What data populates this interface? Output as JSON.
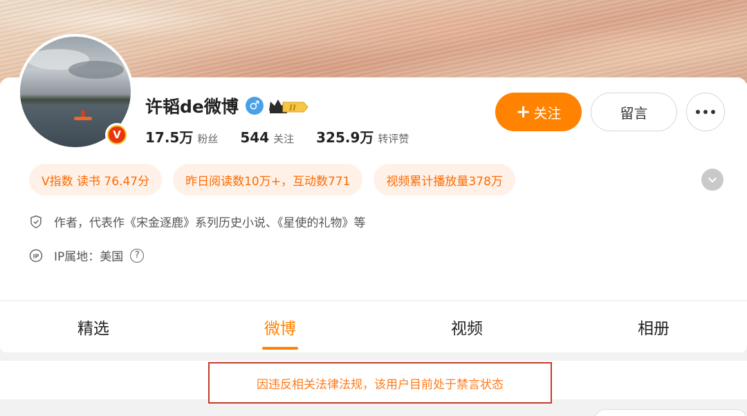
{
  "profile": {
    "name": "许韬de微博",
    "gender_symbol": "♂",
    "verified_letter": "V",
    "level_badge": "II"
  },
  "stats": [
    {
      "value": "17.5万",
      "label": "粉丝"
    },
    {
      "value": "544",
      "label": "关注"
    },
    {
      "value": "325.9万",
      "label": "转评赞"
    }
  ],
  "actions": {
    "follow_plus": "+",
    "follow_label": "关注",
    "message_label": "留言"
  },
  "tags": [
    "V指数 读书 76.47分",
    "昨日阅读数10万+，互动数771",
    "视频累计播放量378万"
  ],
  "info": {
    "description": "作者，代表作《宋金逐鹿》系列历史小说、《星使的礼物》等",
    "ip_location": "IP属地：美国",
    "help_symbol": "?"
  },
  "tabs": [
    {
      "label": "精选"
    },
    {
      "label": "微博"
    },
    {
      "label": "视频"
    },
    {
      "label": "相册"
    }
  ],
  "active_tab": "微博",
  "notice": "因违反相关法律法规，该用户目前处于禁言状态",
  "colors": {
    "accent": "#ff8200",
    "tag_bg": "#fff1e7",
    "notice_border": "#c23b2a",
    "verified_red": "#e8340f",
    "verified_gold": "#f8c51c",
    "gender_blue": "#4aa0e6"
  }
}
